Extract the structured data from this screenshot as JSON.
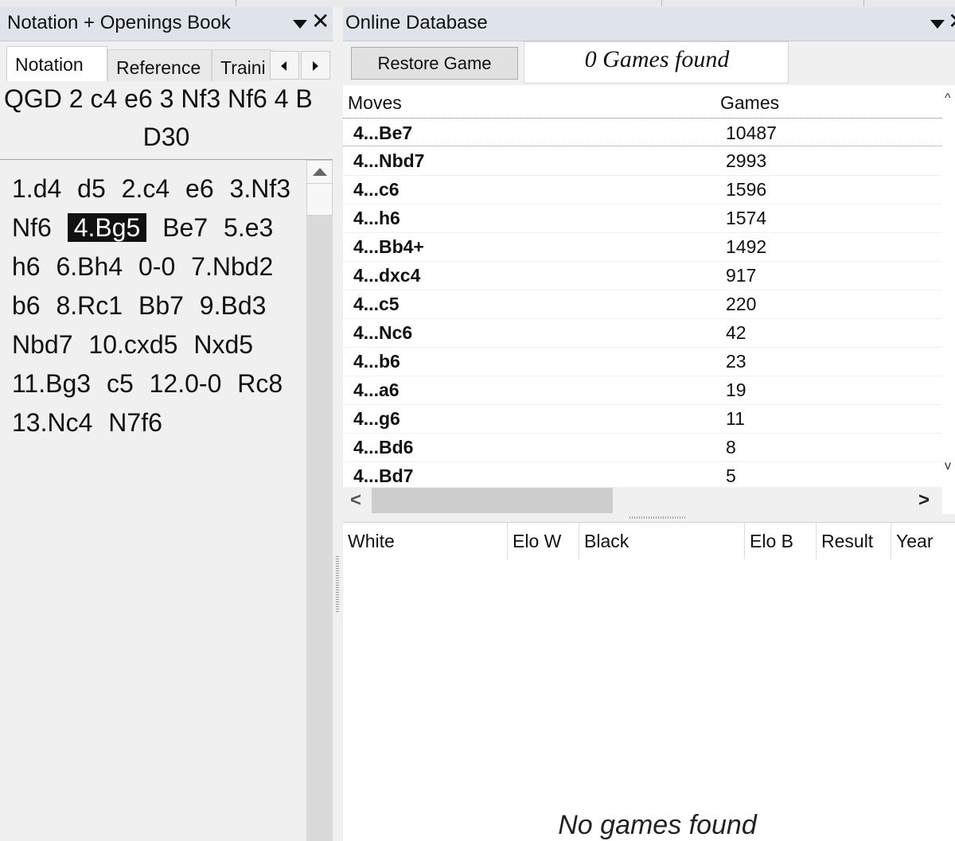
{
  "left_panel": {
    "title": "Notation + Openings Book",
    "tabs": [
      {
        "label": "Notation",
        "active": true
      },
      {
        "label": "Reference",
        "active": false
      },
      {
        "label": "Traini",
        "active": false
      }
    ],
    "opening_line": "QGD 2 c4 e6 3 Nf3 Nf6 4 B",
    "eco": "D30",
    "moves": [
      {
        "text": "1.d4",
        "selected": false
      },
      {
        "text": "d5",
        "selected": false
      },
      {
        "text": "2.c4",
        "selected": false
      },
      {
        "text": "e6",
        "selected": false
      },
      {
        "text": "3.Nf3",
        "selected": false
      },
      {
        "text": "Nf6",
        "selected": false
      },
      {
        "text": "4.Bg5",
        "selected": true
      },
      {
        "text": "Be7",
        "selected": false
      },
      {
        "text": "5.e3",
        "selected": false
      },
      {
        "text": "h6",
        "selected": false
      },
      {
        "text": "6.Bh4",
        "selected": false
      },
      {
        "text": "0-0",
        "selected": false
      },
      {
        "text": "7.Nbd2",
        "selected": false
      },
      {
        "text": "b6",
        "selected": false
      },
      {
        "text": "8.Rc1",
        "selected": false
      },
      {
        "text": "Bb7",
        "selected": false
      },
      {
        "text": "9.Bd3",
        "selected": false
      },
      {
        "text": "Nbd7",
        "selected": false
      },
      {
        "text": "10.cxd5",
        "selected": false
      },
      {
        "text": "Nxd5",
        "selected": false
      },
      {
        "text": "11.Bg3",
        "selected": false
      },
      {
        "text": "c5",
        "selected": false
      },
      {
        "text": "12.0-0",
        "selected": false
      },
      {
        "text": "Rc8",
        "selected": false
      },
      {
        "text": "13.Nc4",
        "selected": false
      },
      {
        "text": "N7f6",
        "selected": false
      }
    ]
  },
  "right_panel": {
    "title": "Online Database",
    "restore_button": "Restore Game",
    "games_found": "0 Games found",
    "columns": {
      "moves": "Moves",
      "games": "Games"
    },
    "rows": [
      {
        "move": "4...Be7",
        "games": "10487"
      },
      {
        "move": "4...Nbd7",
        "games": "2993"
      },
      {
        "move": "4...c6",
        "games": "1596"
      },
      {
        "move": "4...h6",
        "games": "1574"
      },
      {
        "move": "4...Bb4+",
        "games": "1492"
      },
      {
        "move": "4...dxc4",
        "games": "917"
      },
      {
        "move": "4...c5",
        "games": "220"
      },
      {
        "move": "4...Nc6",
        "games": "42"
      },
      {
        "move": "4...b6",
        "games": "23"
      },
      {
        "move": "4...a6",
        "games": "19"
      },
      {
        "move": "4...g6",
        "games": "11"
      },
      {
        "move": "4...Bd6",
        "games": "8"
      },
      {
        "move": "4...Bd7",
        "games": "5"
      }
    ],
    "game_columns": [
      "White",
      "Elo W",
      "Black",
      "Elo B",
      "Result",
      "Year"
    ],
    "empty_message": "No games found"
  },
  "icons": {
    "dropdown": "chevron-down-icon",
    "close": "close-icon",
    "scroll_left": "chevron-left-icon",
    "scroll_right": "chevron-right-icon"
  }
}
